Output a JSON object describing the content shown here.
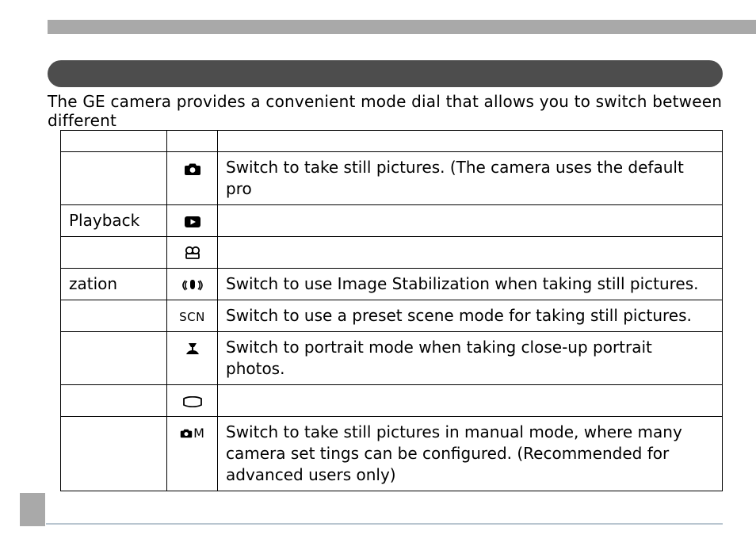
{
  "intro": "The GE camera provides a convenient mode dial that allows you to switch between different",
  "icon_labels": {
    "camera": "camera-icon",
    "playback": "playback-icon",
    "movie": "movie-icon",
    "stabilization": "stabilization-icon",
    "scene": "SCN",
    "portrait": "portrait-icon",
    "panorama": "panorama-icon",
    "manual_suffix": "M"
  },
  "rows": [
    {
      "name": "",
      "icon": "camera",
      "desc": "Switch to take still pictures. (The camera uses the default pro"
    },
    {
      "name": "Playback",
      "icon": "playback",
      "desc": ""
    },
    {
      "name": "",
      "icon": "movie",
      "desc": ""
    },
    {
      "name": "zation",
      "icon": "stabilization",
      "desc": "Switch to use Image Stabilization when taking still pictures."
    },
    {
      "name": "",
      "icon": "scene",
      "desc": "Switch to use a preset scene mode for taking still pictures."
    },
    {
      "name": "",
      "icon": "portrait",
      "desc": "Switch to portrait mode when taking close-up portrait photos."
    },
    {
      "name": "",
      "icon": "panorama",
      "desc": ""
    },
    {
      "name": "",
      "icon": "manual",
      "desc": "Switch to take still pictures in manual mode, where many camera set tings can be configured. (Recommended for advanced users only)"
    }
  ]
}
